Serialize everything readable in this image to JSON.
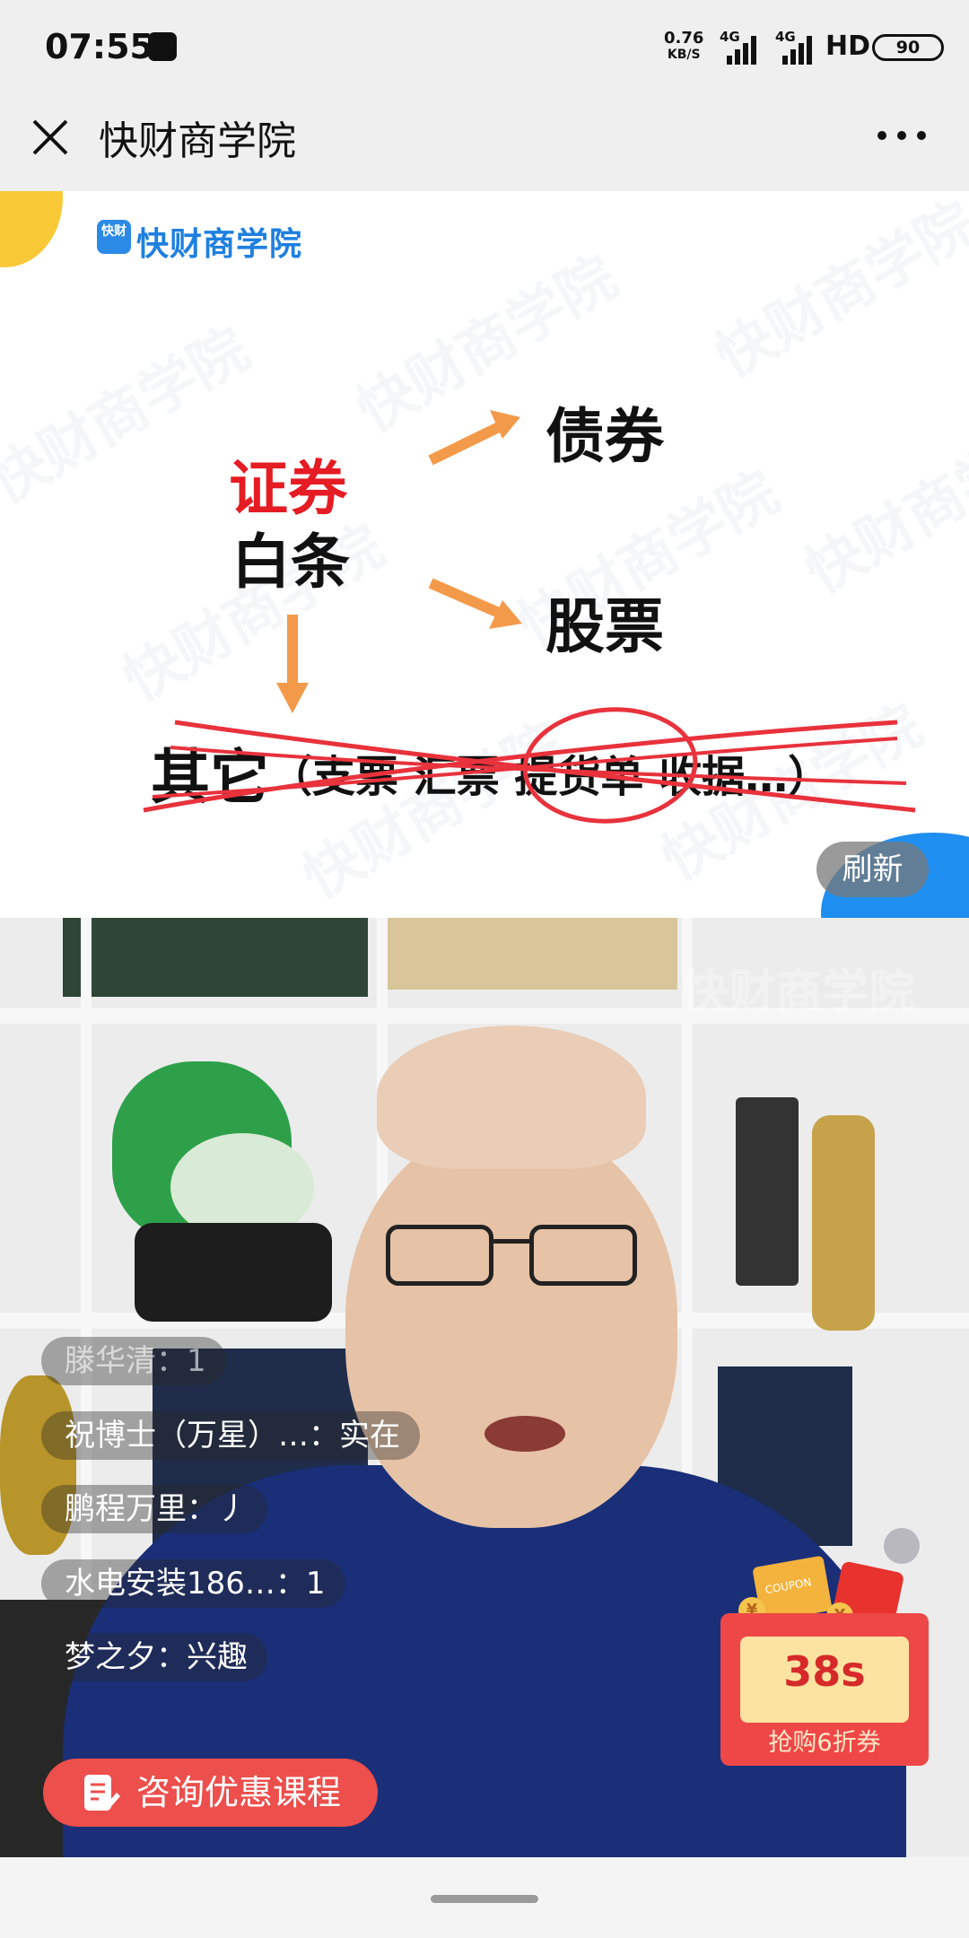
{
  "status_bar": {
    "time": "07:55",
    "net_speed_value": "0.76",
    "net_speed_unit": "KB/S",
    "signal_1_label": "4G",
    "signal_2_label": "4G",
    "hd_label": "HD",
    "battery": "90"
  },
  "titlebar": {
    "title": "快财商学院"
  },
  "slide": {
    "logo_badge": "快财",
    "logo_text": "快财商学院",
    "word_zhengquan": "证券",
    "word_baitiao": "白条",
    "word_zhaiquan": "债券",
    "word_gupiao": "股票",
    "word_qita": "其它",
    "paren_text": "（支票 汇票 提货单 收据…）",
    "refresh_label": "刷新",
    "watermark": "快财商学院",
    "colors": {
      "red_word": "#e51c23",
      "arrow": "#f39a4a",
      "strike": "#e8323c"
    }
  },
  "video": {
    "watermark": "快财商学院",
    "comments": [
      {
        "text": "滕华清：1"
      },
      {
        "text": "祝博士（万星）…：实在"
      },
      {
        "text": "鹏程万里：丿"
      },
      {
        "text": "水电安装186…：1"
      },
      {
        "text": "梦之夕：兴趣"
      }
    ],
    "consult_label": "咨询优惠课程",
    "coupon": {
      "timer": "38s",
      "caption": "抢购6折券",
      "coupon_word": "COUPON",
      "yen": "¥"
    }
  }
}
